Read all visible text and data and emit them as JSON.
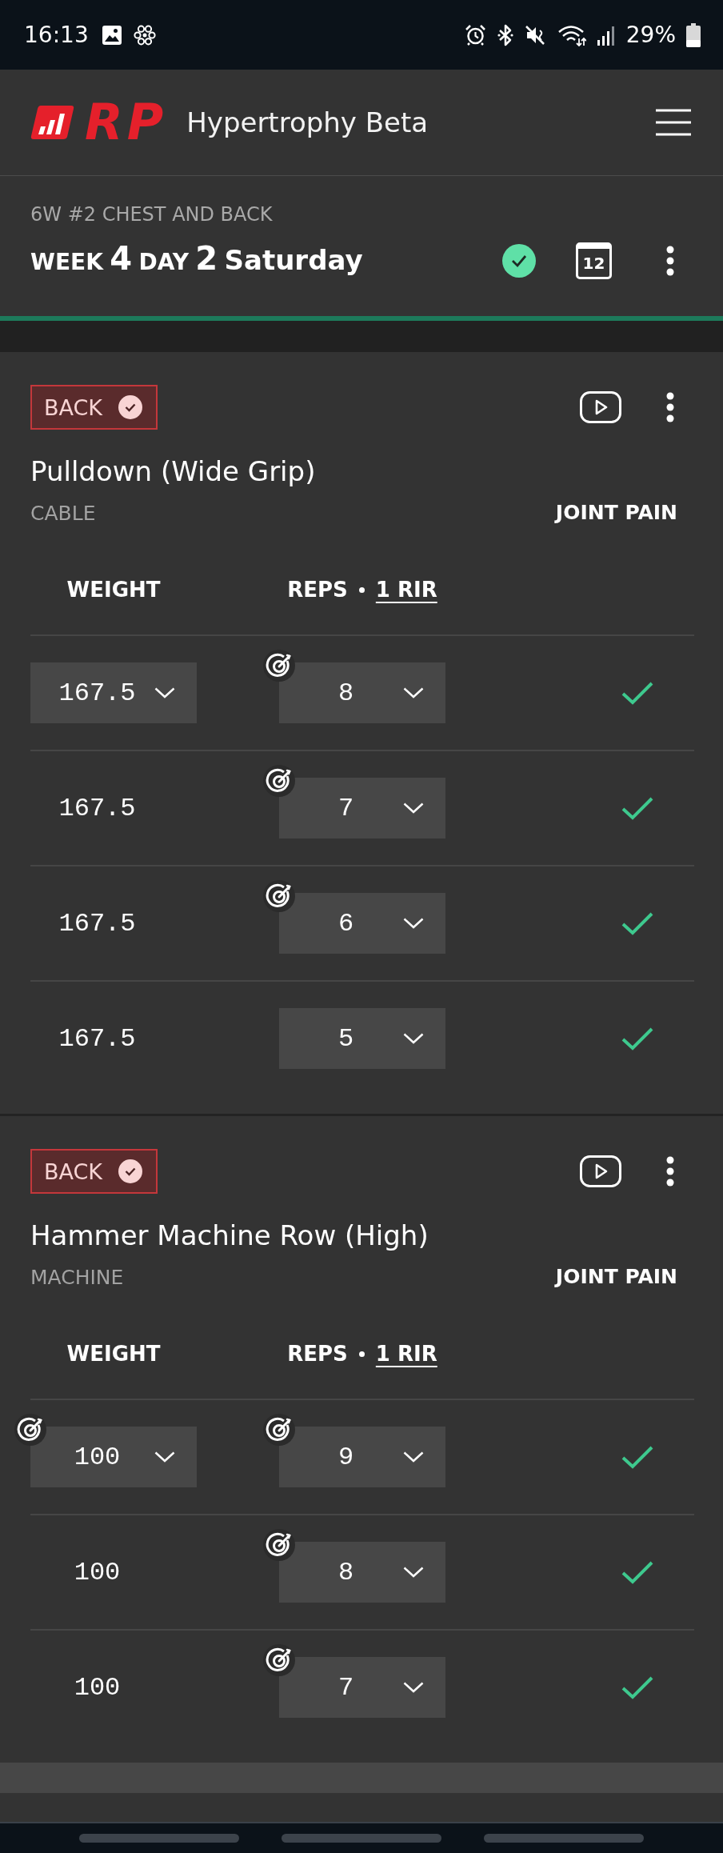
{
  "status_bar": {
    "time": "16:13",
    "battery": "29%"
  },
  "app_header": {
    "logo": "RP",
    "title": "Hypertrophy Beta"
  },
  "workout": {
    "program": "6W #2 CHEST AND BACK",
    "week_label": "WEEK",
    "week": "4",
    "day_label": "DAY",
    "day": "2",
    "weekday": "Saturday",
    "completed": true,
    "calendar_day": "12"
  },
  "exercises": [
    {
      "muscle_group": "BACK",
      "muscle_done": true,
      "name": "Pulldown (Wide Grip)",
      "equipment": "CABLE",
      "joint_pain": "JOINT PAIN",
      "weight_heading": "WEIGHT",
      "reps_heading": "REPS",
      "rir": "1 RIR",
      "sets": [
        {
          "kind": "dropdown",
          "weight": "167.5",
          "weight_target": false,
          "reps": "8",
          "reps_target": true,
          "done": true
        },
        {
          "kind": "plain",
          "weight": "167.5",
          "weight_target": false,
          "reps": "7",
          "reps_target": true,
          "done": true
        },
        {
          "kind": "plain",
          "weight": "167.5",
          "weight_target": false,
          "reps": "6",
          "reps_target": true,
          "done": true
        },
        {
          "kind": "plain",
          "weight": "167.5",
          "weight_target": false,
          "reps": "5",
          "reps_target": false,
          "done": true
        }
      ]
    },
    {
      "muscle_group": "BACK",
      "muscle_done": true,
      "name": "Hammer Machine Row (High)",
      "equipment": "MACHINE",
      "joint_pain": "JOINT PAIN",
      "weight_heading": "WEIGHT",
      "reps_heading": "REPS",
      "rir": "1 RIR",
      "sets": [
        {
          "kind": "dropdown",
          "weight": "100",
          "weight_target": true,
          "reps": "9",
          "reps_target": true,
          "done": true
        },
        {
          "kind": "plain",
          "weight": "100",
          "weight_target": false,
          "reps": "8",
          "reps_target": true,
          "done": true
        },
        {
          "kind": "plain",
          "weight": "100",
          "weight_target": false,
          "reps": "7",
          "reps_target": true,
          "done": true
        }
      ]
    }
  ]
}
